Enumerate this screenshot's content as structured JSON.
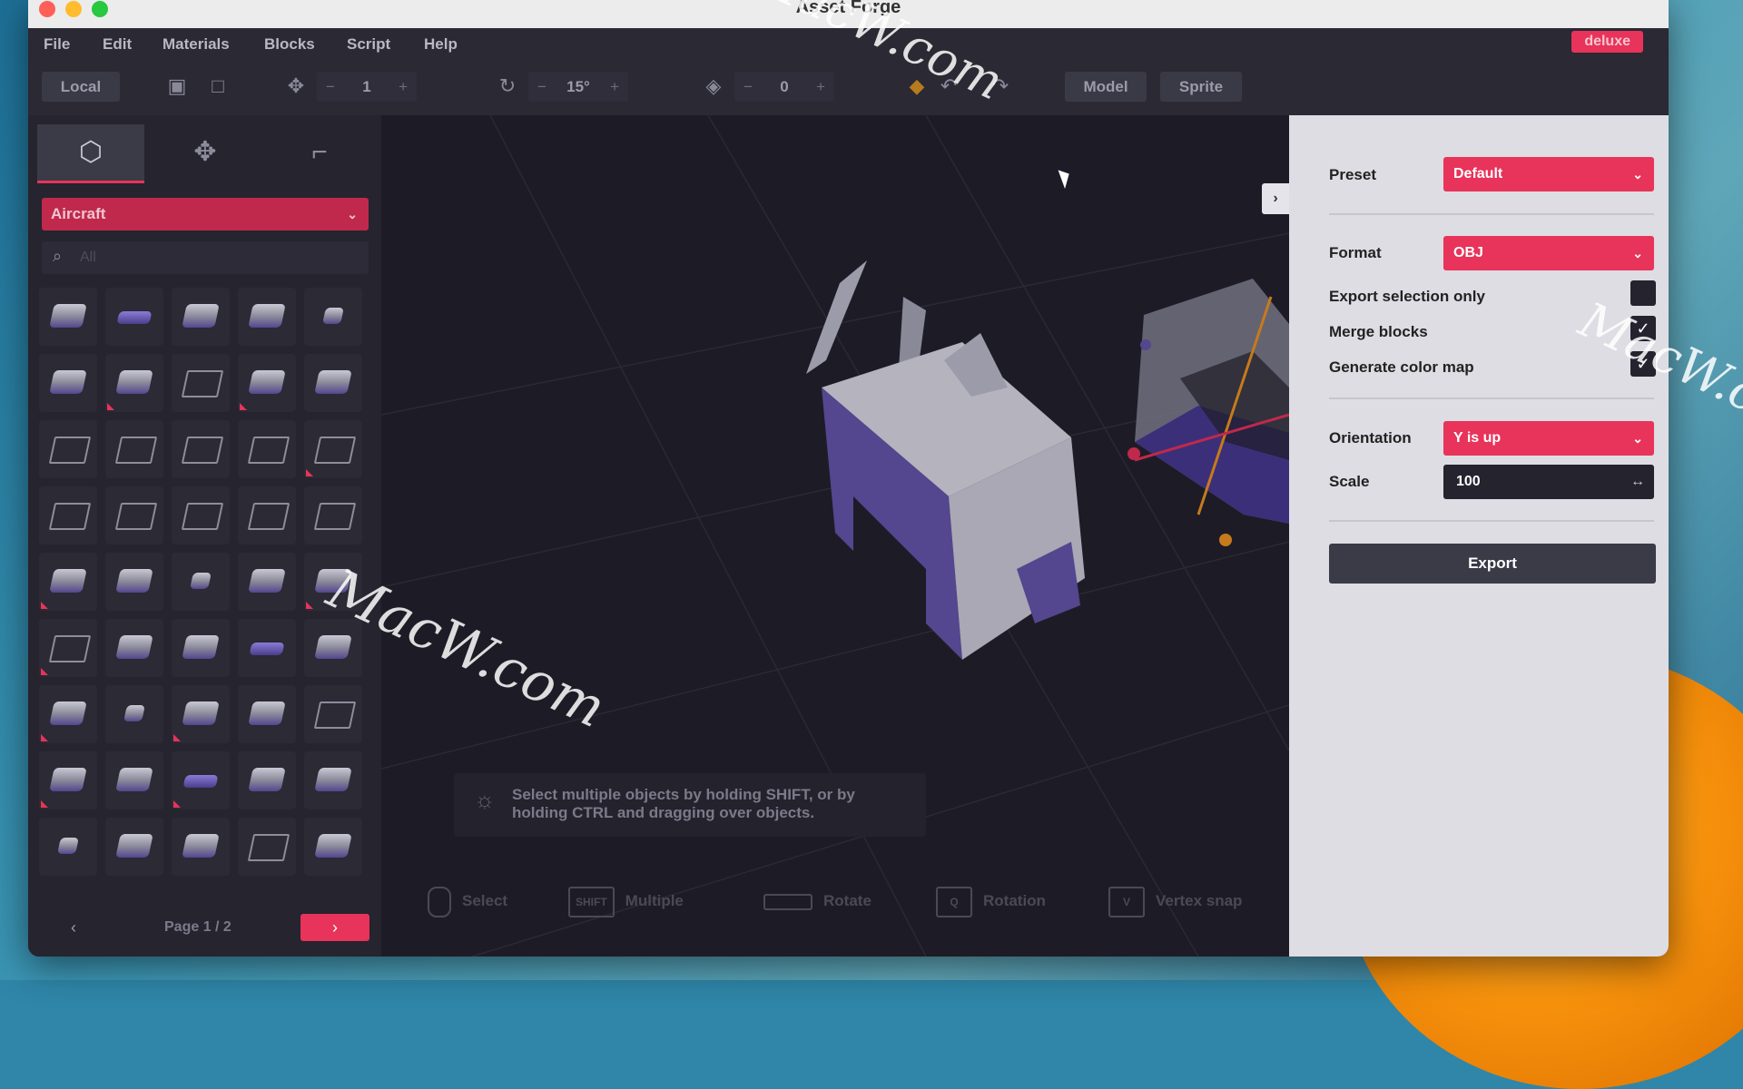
{
  "window": {
    "title": "Asset Forge"
  },
  "menu": [
    "File",
    "Edit",
    "Materials",
    "Blocks",
    "Script",
    "Help"
  ],
  "badge": "deluxe",
  "toolbar": {
    "space": "Local",
    "grid_value": "1",
    "rotation_value": "15°",
    "layer_value": "0",
    "model": "Model",
    "sprite": "Sprite"
  },
  "sidebar": {
    "category": "Aircraft",
    "search_placeholder": "All",
    "page_text": "Page 1 / 2"
  },
  "hint": "Select multiple objects by holding SHIFT, or by holding CTRL and dragging over objects.",
  "shortcuts": [
    {
      "key": "",
      "label": "Select"
    },
    {
      "key": "SHIFT",
      "label": "Multiple"
    },
    {
      "key": "",
      "label": "Rotate"
    },
    {
      "key": "Q",
      "label": "Rotation"
    },
    {
      "key": "V",
      "label": "Vertex snap"
    }
  ],
  "export_panel": {
    "preset_label": "Preset",
    "preset_value": "Default",
    "format_label": "Format",
    "format_value": "OBJ",
    "export_selection_label": "Export selection only",
    "export_selection_checked": false,
    "merge_blocks_label": "Merge blocks",
    "merge_blocks_checked": true,
    "color_map_label": "Generate color map",
    "color_map_checked": true,
    "orientation_label": "Orientation",
    "orientation_value": "Y is up",
    "scale_label": "Scale",
    "scale_value": "100",
    "export_button": "Export"
  },
  "watermark": "MacW.com",
  "colors": {
    "accent": "#e8335a",
    "window_bg": "#1e1d27",
    "panel_bg": "#dedde3",
    "block_purple": "#54468f",
    "block_gray": "#b4b3be"
  },
  "icons": {
    "tool_tabs": [
      "cube-icon",
      "move-arrows-icon",
      "paint-roller-icon"
    ],
    "block_grid_count": 45
  }
}
